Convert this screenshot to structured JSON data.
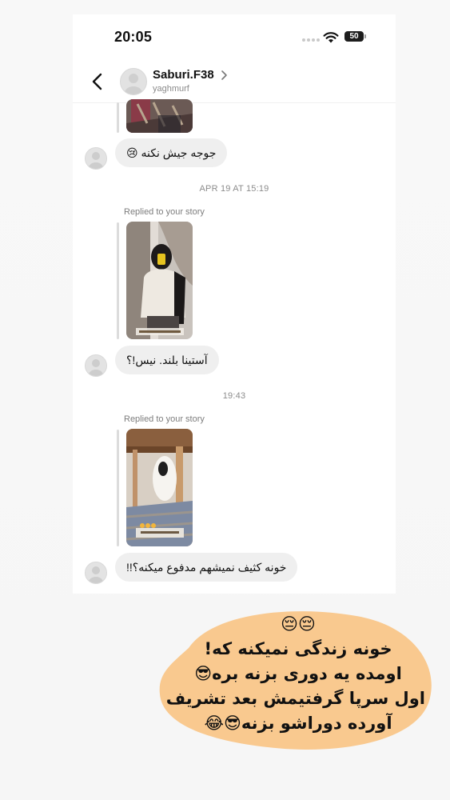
{
  "status_bar": {
    "time": "20:05",
    "battery": "50"
  },
  "header": {
    "name": "Saburi.F38",
    "handle": "yaghmurf"
  },
  "thread": {
    "message_1": "جوجه جیش نکنه 😢",
    "timestamp_1": "APR 19 AT 15:19",
    "reply_label_1": "Replied to your story",
    "message_2": "آستینا بلند. نیس!؟",
    "timestamp_2": "19:43",
    "reply_label_2": "Replied to your story",
    "message_3": "خونه کثیف نمیشهم مدفوع میکنه؟!!"
  },
  "caption": {
    "lines": [
      "😔😔",
      "خونه زندگی نمیکنه که!",
      "اومده یه دوری بزنه بره😎",
      "اول سرپا گرفتیمش بعد تشریف",
      "آورده دوراشو بزنه😎😂"
    ]
  },
  "colors": {
    "bubble": "#efefef",
    "caption_blob": "#f9c98f",
    "muted_text": "#8c8c8c"
  },
  "icons": [
    "back-arrow-icon",
    "chevron-right-icon",
    "wifi-icon",
    "battery-icon",
    "avatar-placeholder-icon"
  ]
}
